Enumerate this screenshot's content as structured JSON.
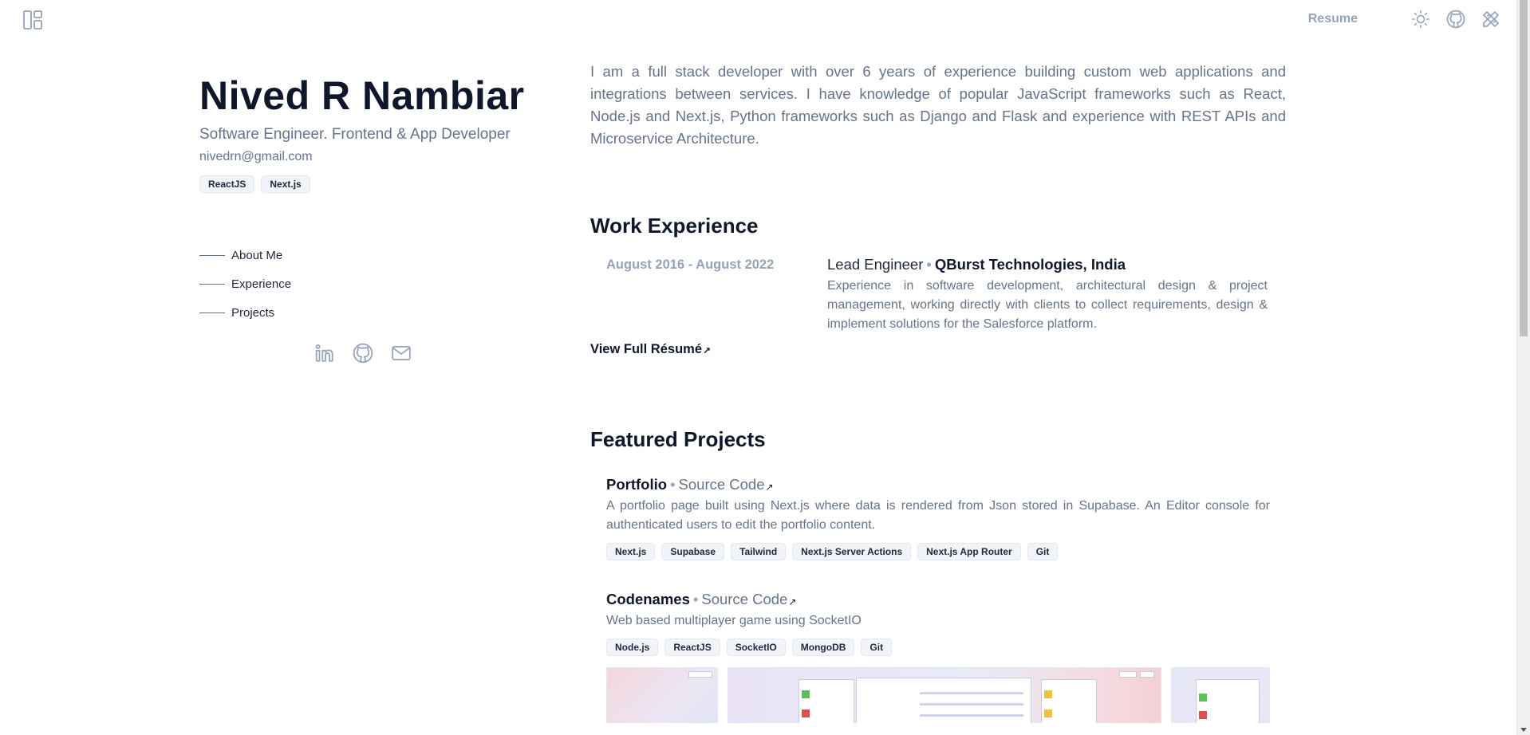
{
  "header": {
    "resume_label": "Resume",
    "icons": [
      "layout-icon",
      "sun-icon",
      "github-icon",
      "pen-ruler-icon"
    ]
  },
  "profile": {
    "name": "Nived R Nambiar",
    "role": "Software Engineer. Frontend & App Developer",
    "email": "nivedrn@gmail.com",
    "tags": [
      "ReactJS",
      "Next.js"
    ]
  },
  "sidenav": {
    "items": [
      {
        "label": "About Me"
      },
      {
        "label": "Experience"
      },
      {
        "label": "Projects"
      }
    ]
  },
  "socials": [
    "linkedin-icon",
    "github-icon",
    "mail-icon"
  ],
  "about": {
    "bio": "I am a full stack developer with over 6 years of experience building custom web applications and integrations between services. I have knowledge of popular JavaScript frameworks such as React, Node.js and Next.js, Python frameworks such as Django and Flask and experience with REST APIs and Microservice Architecture."
  },
  "experience": {
    "title": "Work Experience",
    "items": [
      {
        "dates": "August 2016 - August 2022",
        "position": "Lead Engineer",
        "separator": "•",
        "company": "QBurst Technologies, India",
        "description": "Experience in software development, architectural design & project management, working directly with clients to collect requirements, design & implement solutions for the Salesforce platform."
      }
    ],
    "view_resume": "View Full Résumé",
    "arrow": "↗"
  },
  "projects": {
    "title": "Featured Projects",
    "items": [
      {
        "name": "Portfolio",
        "separator": "•",
        "source_label": "Source Code",
        "arrow": "↗",
        "description": "A portfolio page built using Next.js where data is rendered from Json stored in Supabase. An Editor console for authenticated users to edit the portfolio content.",
        "tags": [
          "Next.js",
          "Supabase",
          "Tailwind",
          "Next.js Server Actions",
          "Next.js App Router",
          "Git"
        ]
      },
      {
        "name": "Codenames",
        "separator": "•",
        "source_label": "Source Code",
        "arrow": "↗",
        "description": "Web based multiplayer game using SocketIO",
        "tags": [
          "Node.js",
          "ReactJS",
          "SocketIO",
          "MongoDB",
          "Git"
        ]
      }
    ]
  },
  "colors": {
    "text_primary": "#0f172a",
    "text_muted": "#64748b",
    "icon_muted": "#94a3b8",
    "tag_bg": "#f1f5f9",
    "background": "#ffffff"
  }
}
